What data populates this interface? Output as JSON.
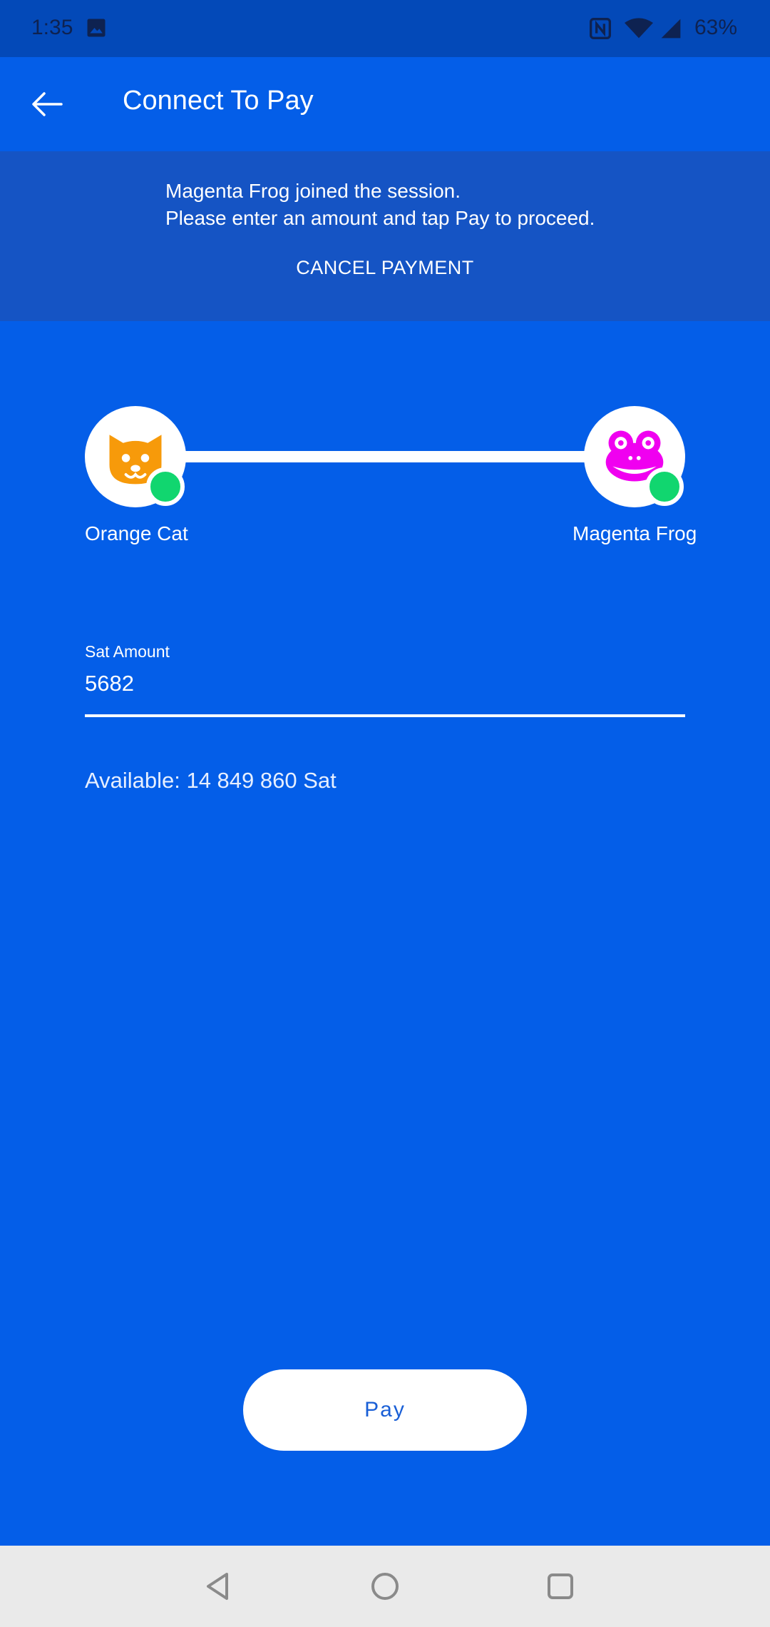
{
  "status_bar": {
    "time": "1:35",
    "battery": "63%",
    "icons": [
      "gallery-icon",
      "nfc-icon",
      "wifi-icon",
      "signal-icon"
    ]
  },
  "app_bar": {
    "title": "Connect To Pay",
    "back_icon": "arrow-left-icon"
  },
  "banner": {
    "line1": "Magenta Frog joined the session.",
    "line2": "Please enter an amount and tap Pay to proceed.",
    "cancel_label": "CANCEL PAYMENT"
  },
  "connection": {
    "payer": {
      "name": "Orange Cat",
      "avatar": "orange-cat-icon",
      "color": "#f79a0a",
      "online": true
    },
    "payee": {
      "name": "Magenta Frog",
      "avatar": "magenta-frog-icon",
      "color": "#f000f0",
      "online": true
    },
    "online_color": "#11d66f"
  },
  "amount_field": {
    "label": "Sat Amount",
    "value": "5682"
  },
  "balance": {
    "text": "Available: 14 849 860 Sat"
  },
  "pay_button": {
    "label": "Pay"
  },
  "nav_bar": {
    "icons": [
      "nav-back-icon",
      "nav-home-icon",
      "nav-recents-icon"
    ]
  },
  "colors": {
    "background": "#045ee8",
    "status_bar": "#0349b8",
    "banner": "#1554c4",
    "nav_bar": "#eaeaea"
  }
}
